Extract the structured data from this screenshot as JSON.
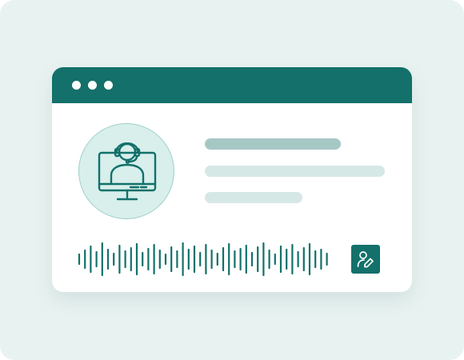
{
  "colors": {
    "accent": "#13706a",
    "page_background": "#e8f2f1",
    "window_background": "#ffffff",
    "avatar_fill": "#d8efec",
    "line_dark": "#a6c8c5",
    "line_light": "#d6e8e6"
  },
  "window": {
    "titlebar_controls": [
      "dot-icon",
      "dot-icon",
      "dot-icon"
    ]
  },
  "profile": {
    "avatar_icon": "support-agent-monitor-icon"
  },
  "placeholder_lines": [
    {
      "tone": "dark"
    },
    {
      "tone": "light"
    },
    {
      "tone": "light"
    }
  ],
  "waveform": {
    "icon": "audio-waveform-icon",
    "levels": [
      0.3,
      0.55,
      0.8,
      0.45,
      1.0,
      0.6,
      0.35,
      0.85,
      0.5,
      0.7,
      0.95,
      0.4,
      0.65,
      0.9,
      0.55,
      0.3,
      0.75,
      0.5,
      1.0,
      0.6,
      0.8,
      0.4,
      0.9,
      0.55,
      0.35,
      0.7,
      0.95,
      0.5,
      0.65,
      0.85,
      0.4,
      0.75,
      1.0,
      0.55,
      0.3,
      0.8,
      0.6,
      0.9,
      0.45,
      0.7,
      0.95,
      0.5,
      0.6,
      0.35
    ]
  },
  "edit_button": {
    "icon": "user-edit-icon"
  }
}
